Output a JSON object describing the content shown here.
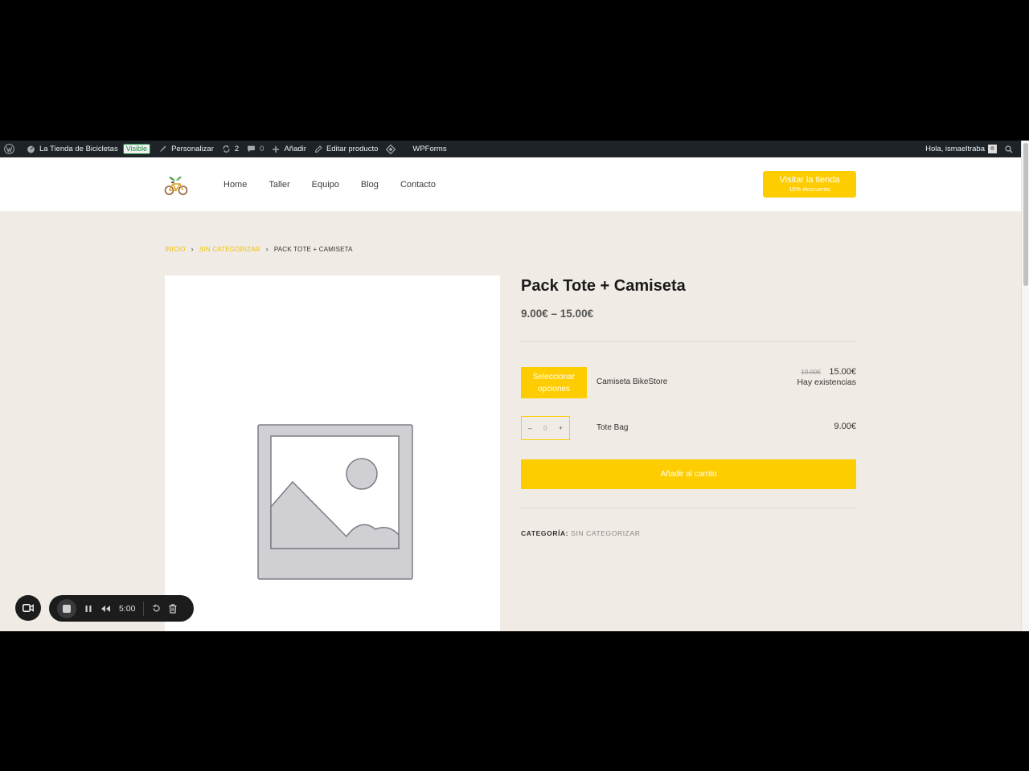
{
  "admin_bar": {
    "site_name": "La Tienda de Bicicletas",
    "visible_badge": "Visible",
    "customize": "Personalizar",
    "updates_count": "2",
    "comments_count": "0",
    "add_new": "Añadir",
    "edit_product": "Editar producto",
    "wpforms": "WPForms",
    "greeting": "Hola, ismaeltraba"
  },
  "header": {
    "nav": [
      "Home",
      "Taller",
      "Equipo",
      "Blog",
      "Contacto"
    ],
    "cta_main": "Visitar la tienda",
    "cta_sub": "10% descuento"
  },
  "breadcrumb": {
    "home": "INICIO",
    "category": "SIN CATEGORIZAR",
    "current": "PACK TOTE + CAMISETA"
  },
  "product": {
    "title": "Pack Tote + Camiseta",
    "price_range": "9.00€ – 15.00€",
    "items": [
      {
        "button": "Seleccionar opciones",
        "name": "Camiseta BikeStore",
        "old_price": "19.00€",
        "price": "15.00€",
        "stock": "Hay existencias"
      },
      {
        "qty_minus": "–",
        "qty_value": "0",
        "qty_plus": "+",
        "name": "Tote Bag",
        "price": "9.00€"
      }
    ],
    "add_to_cart": "Añadir al carrito",
    "category_label": "CATEGORÍA:",
    "category_value": "SIN CATEGORIZAR"
  },
  "recorder": {
    "time": "5:00"
  },
  "colors": {
    "accent": "#fecd00",
    "page_bg": "#f0ebe4",
    "admin_bar": "#1d2327"
  }
}
